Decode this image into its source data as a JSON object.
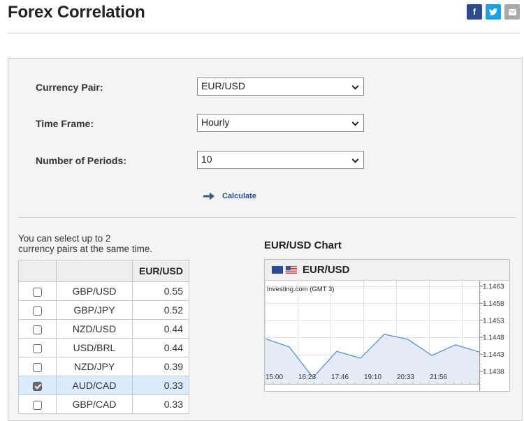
{
  "page": {
    "title": "Forex Correlation",
    "share": [
      {
        "name": "facebook",
        "icon": "facebook-icon",
        "glyph": "f"
      },
      {
        "name": "twitter",
        "icon": "twitter-icon",
        "glyph": "t"
      },
      {
        "name": "email",
        "icon": "email-icon",
        "glyph": "✉"
      }
    ]
  },
  "form": {
    "currency_pair": {
      "label": "Currency Pair:",
      "value": "EUR/USD"
    },
    "time_frame": {
      "label": "Time Frame:",
      "value": "Hourly"
    },
    "periods": {
      "label": "Number of Periods:",
      "value": "10"
    },
    "calculate_label": "Calculate"
  },
  "table": {
    "hint": "You can select up to 2 currency pairs at the same time.",
    "hint_line1": "You can select up to 2",
    "hint_line2": "currency pairs at the same time.",
    "header": [
      "",
      "",
      "EUR/USD"
    ],
    "rows": [
      {
        "pair": "GBP/USD",
        "value": "0.55",
        "checked": false
      },
      {
        "pair": "GBP/JPY",
        "value": "0.52",
        "checked": false
      },
      {
        "pair": "NZD/USD",
        "value": "0.44",
        "checked": false
      },
      {
        "pair": "USD/BRL",
        "value": "0.44",
        "checked": false
      },
      {
        "pair": "NZD/JPY",
        "value": "0.39",
        "checked": false
      },
      {
        "pair": "AUD/CAD",
        "value": "0.33",
        "checked": true
      },
      {
        "pair": "GBP/CAD",
        "value": "0.33",
        "checked": false
      }
    ]
  },
  "colors": {
    "accent": "#1f4f94",
    "selected_row": "#dbeafc",
    "line": "#4a8ad4",
    "area": "#e3eaf6"
  },
  "chart": {
    "section_title": "EUR/USD Chart",
    "header_label": "EUR/USD",
    "source_label": "Investing.com (GMT 3)"
  },
  "chart_data": {
    "type": "area",
    "title": "EUR/USD",
    "xlabel": "",
    "ylabel": "",
    "x_tick_labels": [
      "15:00",
      "16:23",
      "17:46",
      "19:10",
      "20:33",
      "21:56"
    ],
    "y_tick_labels": [
      "1.1463",
      "1.1458",
      "1.1453",
      "1.1448",
      "1.1443",
      "1.1438"
    ],
    "y_ticks": [
      1.1463,
      1.1458,
      1.1453,
      1.1448,
      1.1443,
      1.1438
    ],
    "ylim": [
      1.1434,
      1.1465
    ],
    "grid": true,
    "series": [
      {
        "name": "EUR/USD",
        "values": [
          1.14476,
          1.14452,
          1.14362,
          1.14439,
          1.14419,
          1.14489,
          1.14474,
          1.14427,
          1.14458,
          1.14437
        ]
      }
    ]
  }
}
